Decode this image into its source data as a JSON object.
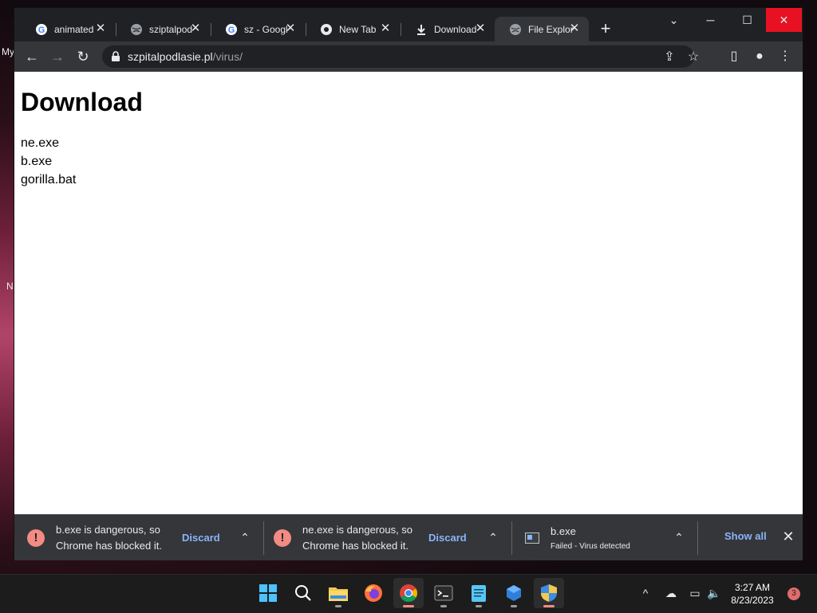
{
  "desktop": {
    "frag_my": "My",
    "frag_n": "N"
  },
  "tabs": [
    {
      "label": "animated",
      "icon": "google-icon",
      "close": "✕"
    },
    {
      "label": "sziptalpod",
      "icon": "globe-icon",
      "close": "✕"
    },
    {
      "label": "sz - Googl",
      "icon": "google-icon",
      "close": "✕"
    },
    {
      "label": "New Tab",
      "icon": "chrome-icon",
      "close": "✕"
    },
    {
      "label": "Download",
      "icon": "download-icon",
      "close": "✕"
    },
    {
      "label": "File Explor",
      "icon": "globe-icon",
      "close": "✕",
      "active": true
    }
  ],
  "new_tab": "+",
  "window_controls": {
    "tab_search": "⌄",
    "minimize": "─",
    "maximize": "☐",
    "close": "✕"
  },
  "toolbar": {
    "back": "←",
    "forward": "→",
    "reload": "↻",
    "url_domain": "szpitalpodlasie.pl",
    "url_path": "/virus/",
    "share_icon": "⇪",
    "star_icon": "☆",
    "sidepanel_icon": "▯",
    "profile_icon": "●",
    "menu_icon": "⋮"
  },
  "page": {
    "heading": "Download",
    "files": [
      "ne.exe",
      "b.exe",
      "gorilla.bat"
    ]
  },
  "downloads": [
    {
      "message_line1": "b.exe is dangerous, so",
      "message_line2": "Chrome has blocked it.",
      "action": "Discard",
      "chevron": "⌃"
    },
    {
      "message_line1": "ne.exe is dangerous, so",
      "message_line2": "Chrome has blocked it.",
      "action": "Discard",
      "chevron": "⌃"
    },
    {
      "name": "b.exe",
      "status": "Failed - Virus detected",
      "chevron": "⌃"
    }
  ],
  "shelf": {
    "show_all": "Show all",
    "close": "✕"
  },
  "taskbar": {
    "apps": [
      "start-icon",
      "search-icon",
      "file-explorer-icon",
      "firefox-icon",
      "chrome-icon",
      "terminal-icon",
      "notepad-icon",
      "sandbox-icon",
      "security-shield-icon"
    ],
    "tray": {
      "chevron": "^",
      "network_off": "☁",
      "display": "▭",
      "volume": "🔈"
    },
    "time": "3:27 AM",
    "date": "8/23/2023",
    "notification_count": "3"
  },
  "colors": {
    "accent_blue": "#8ab4f8",
    "danger": "#f28b82",
    "close_red": "#e81123",
    "chrome_dark": "#202124",
    "toolbar": "#35363a"
  }
}
